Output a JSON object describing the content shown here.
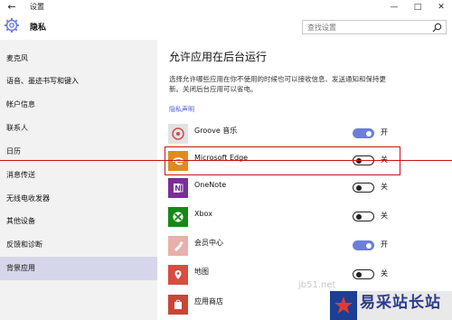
{
  "window": {
    "title": "设置",
    "back_glyph": "←",
    "minimize_glyph": "—",
    "maximize_glyph": "□",
    "close_glyph": "✕"
  },
  "header": {
    "title": "隐私",
    "icon": "gear-icon",
    "search_placeholder": "查找设置"
  },
  "sidebar": {
    "items": [
      {
        "label": "麦克风",
        "active": false
      },
      {
        "label": "语音、墨迹书写和键入",
        "active": false
      },
      {
        "label": "帐户信息",
        "active": false
      },
      {
        "label": "联系人",
        "active": false
      },
      {
        "label": "日历",
        "active": false
      },
      {
        "label": "消息传送",
        "active": false
      },
      {
        "label": "无线电收发器",
        "active": false
      },
      {
        "label": "其他设备",
        "active": false
      },
      {
        "label": "反馈和诊断",
        "active": false
      },
      {
        "label": "背景应用",
        "active": true
      }
    ]
  },
  "main": {
    "title": "允许应用在后台运行",
    "description": "选择允许哪些应用在你不使用的时候也可以接收信息、发送通知和保持更新。关闭后台应用可以省电。",
    "privacy_link": "隐私声明"
  },
  "apps": [
    {
      "name": "Groove 音乐",
      "state": "开",
      "on": true,
      "icon": "groove-music-icon",
      "color": "#e2e2e2"
    },
    {
      "name": "Microsoft Edge",
      "state": "关",
      "on": false,
      "icon": "edge-icon",
      "color": "#e08a1e"
    },
    {
      "name": "OneNote",
      "state": "关",
      "on": false,
      "icon": "onenote-icon",
      "color": "#7b2d99"
    },
    {
      "name": "Xbox",
      "state": "关",
      "on": false,
      "icon": "xbox-icon",
      "color": "#138a13"
    },
    {
      "name": "会员中心",
      "state": "开",
      "on": true,
      "icon": "insider-hub-icon",
      "color": "#e8b0aa"
    },
    {
      "name": "地图",
      "state": "关",
      "on": false,
      "icon": "maps-icon",
      "color": "#d94c3f"
    },
    {
      "name": "应用商店",
      "state": "",
      "on": false,
      "icon": "store-icon",
      "color": "#c94535"
    }
  ],
  "colors": {
    "accent": "#6b7fd8",
    "sidebar_bg": "#f2f2f2",
    "active_nav": "#d6d6ea",
    "annotation_red": "#c01818"
  },
  "watermark": {
    "text": "易采站长站",
    "url_fragment": "jb51.net"
  }
}
